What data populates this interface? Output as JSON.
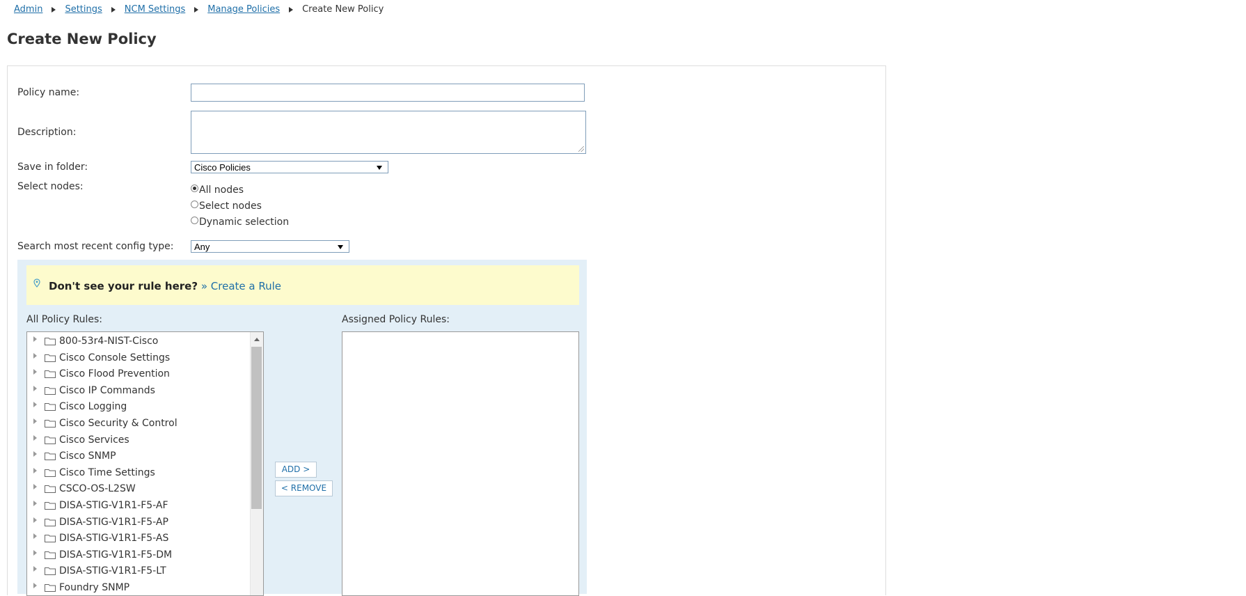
{
  "breadcrumb": {
    "items": [
      "Admin",
      "Settings",
      "NCM Settings",
      "Manage Policies"
    ],
    "current": "Create New Policy"
  },
  "page": {
    "title": "Create New Policy"
  },
  "form": {
    "policy_name_label": "Policy name:",
    "policy_name_value": "",
    "description_label": "Description:",
    "description_value": "",
    "save_in_folder_label": "Save in folder:",
    "save_in_folder_value": "Cisco Policies",
    "select_nodes_label": "Select nodes:",
    "select_nodes_options": [
      "All nodes",
      "Select nodes",
      "Dynamic selection"
    ],
    "select_nodes_selected": "All nodes",
    "config_type_label": "Search most recent config type:",
    "config_type_value": "Any"
  },
  "notice": {
    "bold_text": "Don't see your rule here?",
    "link_text": "» Create a Rule"
  },
  "rules": {
    "all_label": "All Policy Rules:",
    "assigned_label": "Assigned Policy Rules:",
    "add_button": "ADD >",
    "remove_button": "< REMOVE",
    "items": [
      "800-53r4-NIST-Cisco",
      "Cisco Console Settings",
      "Cisco Flood Prevention",
      "Cisco IP Commands",
      "Cisco Logging",
      "Cisco Security & Control",
      "Cisco Services",
      "Cisco SNMP",
      "Cisco Time Settings",
      "CSCO-OS-L2SW",
      "DISA-STIG-V1R1-F5-AF",
      "DISA-STIG-V1R1-F5-AP",
      "DISA-STIG-V1R1-F5-AS",
      "DISA-STIG-V1R1-F5-DM",
      "DISA-STIG-V1R1-F5-LT",
      "Foundry SNMP"
    ],
    "assigned_items": []
  },
  "colors": {
    "link": "#1f6fa8",
    "panel_bg": "#e3eff7",
    "notice_bg": "#fdfbcd"
  }
}
